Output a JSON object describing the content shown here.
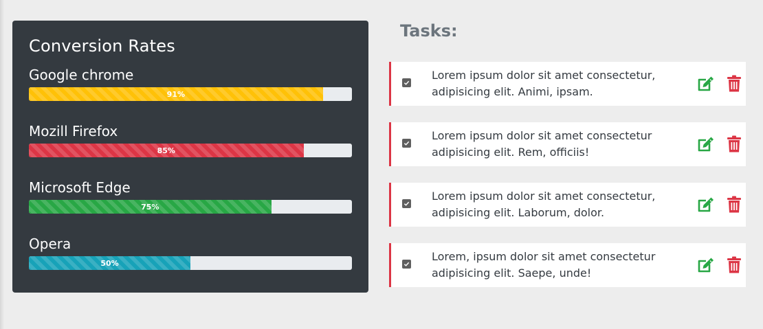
{
  "conversion": {
    "title": "Conversion Rates",
    "items": [
      {
        "label": "Google chrome",
        "percent": 91,
        "percent_label": "91%",
        "color": "#ffc107"
      },
      {
        "label": "Mozill Firefox",
        "percent": 85,
        "percent_label": "85%",
        "color": "#dc3545"
      },
      {
        "label": "Microsoft Edge",
        "percent": 75,
        "percent_label": "75%",
        "color": "#28a745"
      },
      {
        "label": "Opera",
        "percent": 50,
        "percent_label": "50%",
        "color": "#17a2b8"
      }
    ]
  },
  "tasks": {
    "title": "Tasks:",
    "items": [
      {
        "text": "Lorem ipsum dolor sit amet consectetur, adipisicing elit. Animi, ipsam.",
        "checked": true
      },
      {
        "text": "Lorem ipsum dolor sit amet consectetur adipisicing elit. Rem, officiis!",
        "checked": true
      },
      {
        "text": "Lorem ipsum dolor sit amet consectetur, adipisicing elit. Laborum, dolor.",
        "checked": true
      },
      {
        "text": "Lorem, ipsum dolor sit amet consectetur adipisicing elit. Saepe, unde!",
        "checked": true
      }
    ],
    "edit_icon": "edit-icon",
    "delete_icon": "trash-icon",
    "edit_color": "#28a745",
    "delete_color": "#dc3545"
  }
}
